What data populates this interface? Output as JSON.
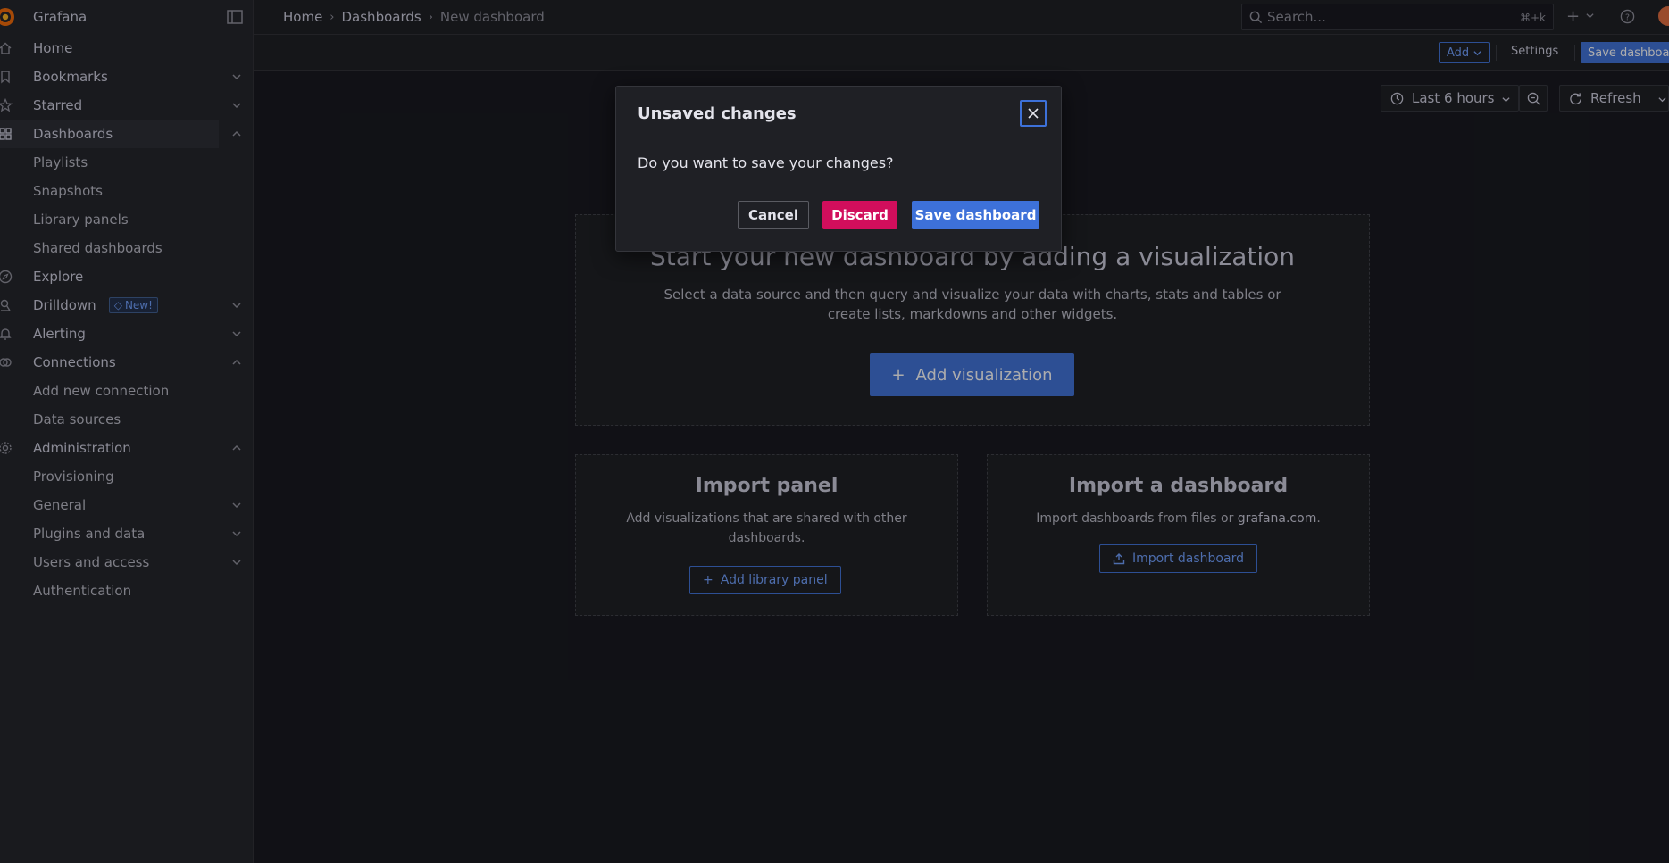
{
  "app": {
    "brand": "Grafana"
  },
  "sidebar": {
    "items": [
      {
        "label": "Home",
        "level": "top",
        "icon": "home-icon",
        "chevron": ""
      },
      {
        "label": "Bookmarks",
        "level": "top",
        "icon": "bookmark-icon",
        "chevron": "down"
      },
      {
        "label": "Starred",
        "level": "top",
        "icon": "star-icon",
        "chevron": "down"
      },
      {
        "label": "Dashboards",
        "level": "top",
        "icon": "apps-icon",
        "chevron": "up",
        "active": true
      },
      {
        "label": "Playlists",
        "level": "sub"
      },
      {
        "label": "Snapshots",
        "level": "sub"
      },
      {
        "label": "Library panels",
        "level": "sub"
      },
      {
        "label": "Shared dashboards",
        "level": "sub"
      },
      {
        "label": "Explore",
        "level": "top",
        "icon": "compass-icon",
        "chevron": ""
      },
      {
        "label": "Drilldown",
        "level": "top",
        "icon": "drilldown-icon",
        "chevron": "down",
        "badge": "New!"
      },
      {
        "label": "Alerting",
        "level": "top",
        "icon": "bell-icon",
        "chevron": "down"
      },
      {
        "label": "Connections",
        "level": "top",
        "icon": "link-icon",
        "chevron": "up"
      },
      {
        "label": "Add new connection",
        "level": "sub"
      },
      {
        "label": "Data sources",
        "level": "sub"
      },
      {
        "label": "Administration",
        "level": "top",
        "icon": "cog-icon",
        "chevron": "up"
      },
      {
        "label": "Provisioning",
        "level": "sub"
      },
      {
        "label": "General",
        "level": "sub",
        "chevron": "down"
      },
      {
        "label": "Plugins and data",
        "level": "sub",
        "chevron": "down"
      },
      {
        "label": "Users and access",
        "level": "sub",
        "chevron": "down"
      },
      {
        "label": "Authentication",
        "level": "sub"
      }
    ]
  },
  "topbar": {
    "breadcrumbs": [
      "Home",
      "Dashboards",
      "New dashboard"
    ],
    "search": {
      "placeholder": "Search...",
      "shortcut": "⌘+k"
    },
    "plus_label": "+"
  },
  "toolbar": {
    "add_label": "Add",
    "settings_label": "Settings",
    "save_label": "Save dashboard"
  },
  "controls": {
    "time_range": "Last 6 hours",
    "refresh_label": "Refresh"
  },
  "empty_state": {
    "title": "Start your new dashboard by adding a visualization",
    "description": "Select a data source and then query and visualize your data with charts, stats and tables or create lists, markdowns and other widgets.",
    "add_visualization_label": "Add visualization"
  },
  "import_panel": {
    "title": "Import panel",
    "description": "Add visualizations that are shared with other dashboards.",
    "button_label": "Add library panel"
  },
  "import_dashboard": {
    "title": "Import a dashboard",
    "description_prefix": "Import dashboards from files or ",
    "link_text": "grafana.com",
    "description_suffix": ".",
    "button_label": "Import dashboard"
  },
  "modal": {
    "title": "Unsaved changes",
    "body": "Do you want to save your changes?",
    "cancel_label": "Cancel",
    "discard_label": "Discard",
    "save_label": "Save dashboard"
  },
  "colors": {
    "primary": "#3d71d9",
    "destructive": "#d10e5c",
    "background": "#111217",
    "panel": "#18191d"
  }
}
